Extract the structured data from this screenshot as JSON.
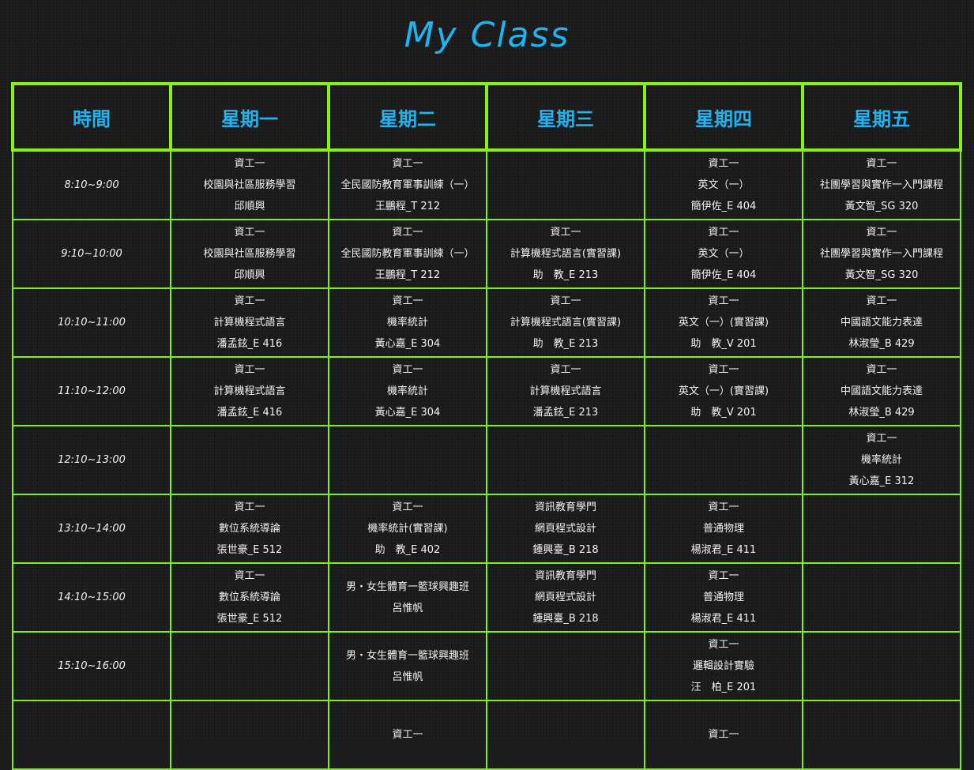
{
  "page": {
    "title": "My Class"
  },
  "headers": [
    "時間",
    "星期一",
    "星期二",
    "星期三",
    "星期四",
    "星期五"
  ],
  "rows": [
    {
      "time": "8:10~9:00",
      "cells": [
        [
          "資工一",
          "校園與社區服務學習",
          "邱順興"
        ],
        [
          "資工一",
          "全民國防教育軍事訓練（一）",
          "王鵬程_T 212"
        ],
        [],
        [
          "資工一",
          "英文（一）",
          "簡伊佐_E 404"
        ],
        [
          "資工一",
          "社團學習與實作一入門課程",
          "黃文智_SG 320"
        ]
      ]
    },
    {
      "time": "9:10~10:00",
      "cells": [
        [
          "資工一",
          "校園與社區服務學習",
          "邱順興"
        ],
        [
          "資工一",
          "全民國防教育軍事訓練（一）",
          "王鵬程_T 212"
        ],
        [
          "資工一",
          "計算機程式語言(實習課)",
          "助　教_E 213"
        ],
        [
          "資工一",
          "英文（一）",
          "簡伊佐_E 404"
        ],
        [
          "資工一",
          "社團學習與實作一入門課程",
          "黃文智_SG 320"
        ]
      ]
    },
    {
      "time": "10:10~11:00",
      "cells": [
        [
          "資工一",
          "計算機程式語言",
          "潘孟鉉_E 416"
        ],
        [
          "資工一",
          "機率統計",
          "黃心嘉_E 304"
        ],
        [
          "資工一",
          "計算機程式語言(實習課)",
          "助　教_E 213"
        ],
        [
          "資工一",
          "英文（一）(實習課)",
          "助　教_V 201"
        ],
        [
          "資工一",
          "中國語文能力表達",
          "林淑瑩_B 429"
        ]
      ]
    },
    {
      "time": "11:10~12:00",
      "cells": [
        [
          "資工一",
          "計算機程式語言",
          "潘孟鉉_E 416"
        ],
        [
          "資工一",
          "機率統計",
          "黃心嘉_E 304"
        ],
        [
          "資工一",
          "計算機程式語言",
          "潘孟鉉_E 213"
        ],
        [
          "資工一",
          "英文（一）(實習課)",
          "助　教_V 201"
        ],
        [
          "資工一",
          "中國語文能力表達",
          "林淑瑩_B 429"
        ]
      ]
    },
    {
      "time": "12:10~13:00",
      "cells": [
        [],
        [],
        [],
        [],
        [
          "資工一",
          "機率統計",
          "黃心嘉_E 312"
        ]
      ]
    },
    {
      "time": "13:10~14:00",
      "cells": [
        [
          "資工一",
          "數位系統導論",
          "張世豪_E 512"
        ],
        [
          "資工一",
          "機率統計(實習課)",
          "助　教_E 402"
        ],
        [
          "資訊教育學門",
          "網頁程式設計",
          "鍾興臺_B 218"
        ],
        [
          "資工一",
          "普通物理",
          "楊淑君_E 411"
        ],
        []
      ]
    },
    {
      "time": "14:10~15:00",
      "cells": [
        [
          "資工一",
          "數位系統導論",
          "張世豪_E 512"
        ],
        [
          "男・女生體育一籃球興趣班",
          "呂惟帆"
        ],
        [
          "資訊教育學門",
          "網頁程式設計",
          "鍾興臺_B 218"
        ],
        [
          "資工一",
          "普通物理",
          "楊淑君_E 411"
        ],
        []
      ]
    },
    {
      "time": "15:10~16:00",
      "cells": [
        [],
        [
          "男・女生體育一籃球興趣班",
          "呂惟帆"
        ],
        [],
        [
          "資工一",
          "邏輯設計實驗",
          "汪　柏_E 201"
        ],
        []
      ]
    },
    {
      "time": "",
      "cells": [
        [],
        [
          "資工一"
        ],
        [],
        [
          "資工一"
        ],
        []
      ]
    }
  ]
}
